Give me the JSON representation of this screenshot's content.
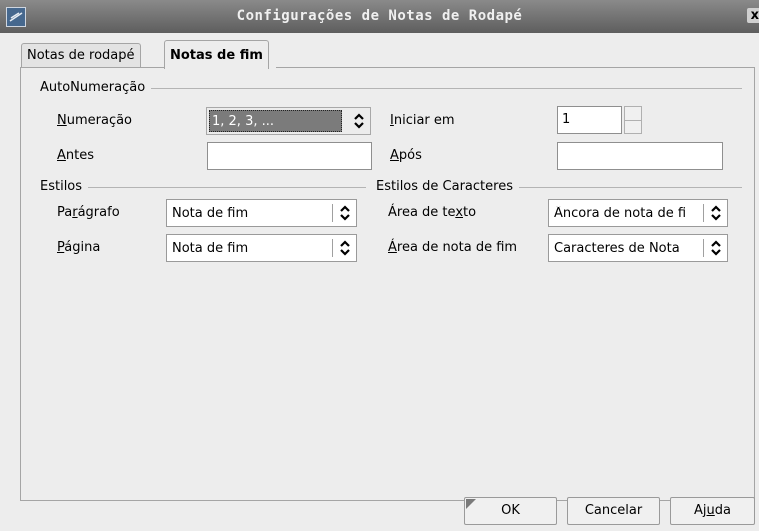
{
  "window": {
    "title": "Configurações de Notas de Rodapé",
    "close_glyph": "x"
  },
  "tabs": [
    {
      "label": "Notas de rodapé",
      "active": false
    },
    {
      "label": "Notas de fim",
      "active": true
    }
  ],
  "autonumbering": {
    "section_label": "AutoNumeração",
    "numbering": {
      "label_mn": "N",
      "label_rest": "umeração",
      "value": "1, 2, 3, ..."
    },
    "start_at": {
      "label_mn": "I",
      "label_rest": "niciar em",
      "value": "1"
    },
    "before": {
      "label_mn": "A",
      "label_rest": "ntes",
      "value": ""
    },
    "after": {
      "label_mn": "A",
      "label_rest": "pós",
      "value": ""
    }
  },
  "styles": {
    "section_label": "Estilos",
    "paragraph": {
      "label_pre": "Pa",
      "label_mn": "r",
      "label_rest": "ágrafo",
      "value": "Nota de fim"
    },
    "page": {
      "label_mn": "P",
      "label_rest": "ágina",
      "value": "Nota de fim"
    }
  },
  "char_styles": {
    "section_label": "Estilos de Caracteres",
    "text_area": {
      "label_pre": "Área de te",
      "label_mn": "x",
      "label_rest": "to",
      "value": "Âncora de nota de fi"
    },
    "endnote_area": {
      "label_mn": "Á",
      "label_rest": "rea de nota de fim",
      "value": "Caracteres de Nota"
    }
  },
  "buttons": {
    "ok": "OK",
    "cancel": "Cancelar",
    "help_pre": "Aj",
    "help_mn": "u",
    "help_rest": "da"
  },
  "icons": {
    "app": "writer-app-icon",
    "updown": "updown-arrows-icon"
  }
}
